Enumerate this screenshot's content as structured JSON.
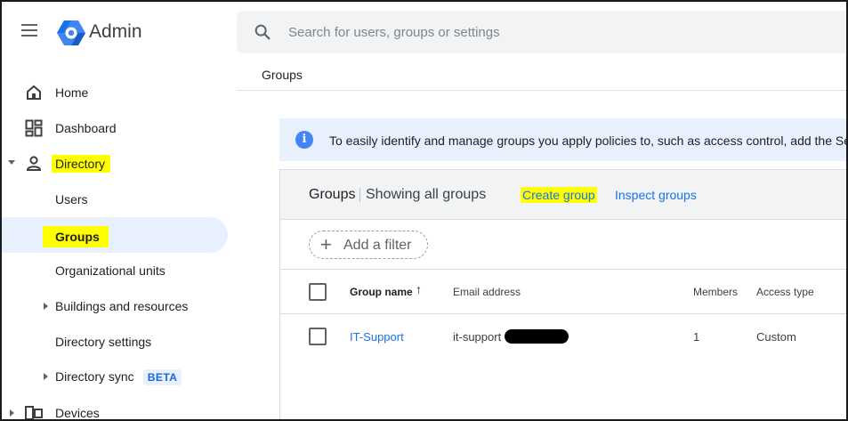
{
  "header": {
    "app_title": "Admin",
    "search_placeholder": "Search for users, groups or settings",
    "breadcrumb": "Groups"
  },
  "sidebar": {
    "items": [
      {
        "label": "Home",
        "icon": "home-icon"
      },
      {
        "label": "Dashboard",
        "icon": "dashboard-icon"
      },
      {
        "label": "Directory",
        "icon": "person-icon",
        "expanded": true,
        "highlighted": true
      },
      {
        "label": "Users"
      },
      {
        "label": "Groups",
        "active": true,
        "highlighted": true
      },
      {
        "label": "Organizational units"
      },
      {
        "label": "Buildings and resources",
        "collapsed": true
      },
      {
        "label": "Directory settings"
      },
      {
        "label": "Directory sync",
        "badge": "BETA",
        "collapsed": true
      },
      {
        "label": "Devices",
        "icon": "devices-icon",
        "collapsed": true
      }
    ]
  },
  "banner": {
    "icon": "info-icon",
    "text": "To easily identify and manage groups you apply policies to, such as access control, add the Se"
  },
  "groups_card": {
    "title": "Groups",
    "subtitle": "Showing all groups",
    "create_group": "Create group",
    "inspect_groups": "Inspect groups",
    "add_filter": "Add a filter",
    "columns": {
      "group_name": "Group name",
      "email": "Email address",
      "members": "Members",
      "access_type": "Access type"
    },
    "rows": [
      {
        "group_name": "IT-Support",
        "email": "it-support",
        "email_redacted": true,
        "members": "1",
        "access_type": "Custom"
      }
    ]
  },
  "colors": {
    "accent": "#1a73e8",
    "highlight": "#ffff00",
    "active_bg": "#e8f0fe",
    "banner_bg": "#e8f0fe"
  }
}
